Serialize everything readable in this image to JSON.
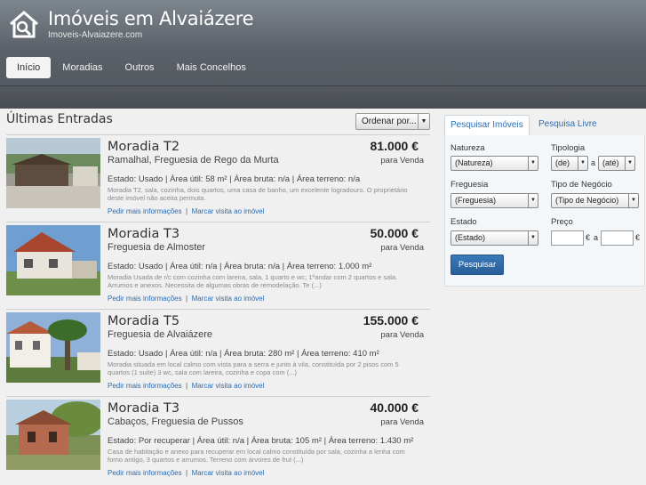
{
  "header": {
    "title": "Imóveis em Alvaiázere",
    "url": "Imoveis-Alvaiazere.com",
    "logo_icon": "house-search-icon"
  },
  "nav": [
    {
      "label": "Início",
      "active": true
    },
    {
      "label": "Moradias"
    },
    {
      "label": "Outros"
    },
    {
      "label": "Mais Concelhos"
    }
  ],
  "main": {
    "title": "Últimas Entradas",
    "sort_label": "Ordenar por..."
  },
  "listings": [
    {
      "title": "Moradia  T2",
      "location": "Ramalhal, Freguesia de Rego da Murta",
      "price": "81.000 €",
      "price_type": "para Venda",
      "details": "Estado: Usado  | Área útil: 58 m²  | Área bruta: n/a  | Área terreno: n/a",
      "description": "Moradia T2, sala, cozinha, dois quartos, uma casa de banho, um excelente logradouro. O proprietário deste imóvel não aceita permuta.",
      "link_info": "Pedir mais informações",
      "link_visit": "Marcar visita ao imóvel"
    },
    {
      "title": "Moradia  T3",
      "location": "Freguesia de Almoster",
      "price": "50.000 €",
      "price_type": "para Venda",
      "details": "Estado: Usado  | Área útil: n/a  | Área bruta: n/a  | Área terreno: 1.000 m²",
      "description": "Moradia Usada de r/c com cozinha com lareira, sala, 1 quarto e wc; 1ºandar com 2 quartos e sala. Arrumos e anexos. Necessita de algumas obras de remodelação. Te (...)",
      "link_info": "Pedir mais informações",
      "link_visit": "Marcar visita ao imóvel"
    },
    {
      "title": "Moradia  T5",
      "location": "Freguesia de Alvaiázere",
      "price": "155.000 €",
      "price_type": "para Venda",
      "details": "Estado: Usado  | Área útil: n/a  | Área bruta: 280 m²  | Área terreno: 410 m²",
      "description": "Moradia situada em local calmo com vista para a serra e junto à vila, constituída por 2 pisos com 5 quartos (1 suite) 3 wc, sala com lareira, cozinha e copa com (...)",
      "link_info": "Pedir mais informações",
      "link_visit": "Marcar visita ao imóvel"
    },
    {
      "title": "Moradia  T3",
      "location": "Cabaços, Freguesia de Pussos",
      "price": "40.000 €",
      "price_type": "para Venda",
      "details": "Estado: Por recuperar  | Área útil: n/a  | Área bruta: 105 m²  | Área terreno: 1.430 m²",
      "description": "Casa de habitação e anexo para recuperar em local calmo constituída por sala, cozinha a lenha com forno antigo, 3 quartos e arrumos. Terreno com árvores de frut (...)",
      "link_info": "Pedir mais informações",
      "link_visit": "Marcar visita ao imóvel"
    }
  ],
  "search": {
    "tab_active": "Pesquisar Imóveis",
    "tab_other": "Pesquisa Livre",
    "natureza_label": "Natureza",
    "natureza_value": "(Natureza)",
    "tipologia_label": "Tipologia",
    "tipologia_from": "(de)",
    "tipologia_sep": "a",
    "tipologia_to": "(até)",
    "freguesia_label": "Freguesia",
    "freguesia_value": "(Freguesia)",
    "negocio_label": "Tipo de Negócio",
    "negocio_value": "(Tipo de Negócio)",
    "estado_label": "Estado",
    "estado_value": "(Estado)",
    "preco_label": "Preço",
    "preco_cur1": "€",
    "preco_sep": "a",
    "preco_cur2": "€",
    "button": "Pesquisar"
  }
}
